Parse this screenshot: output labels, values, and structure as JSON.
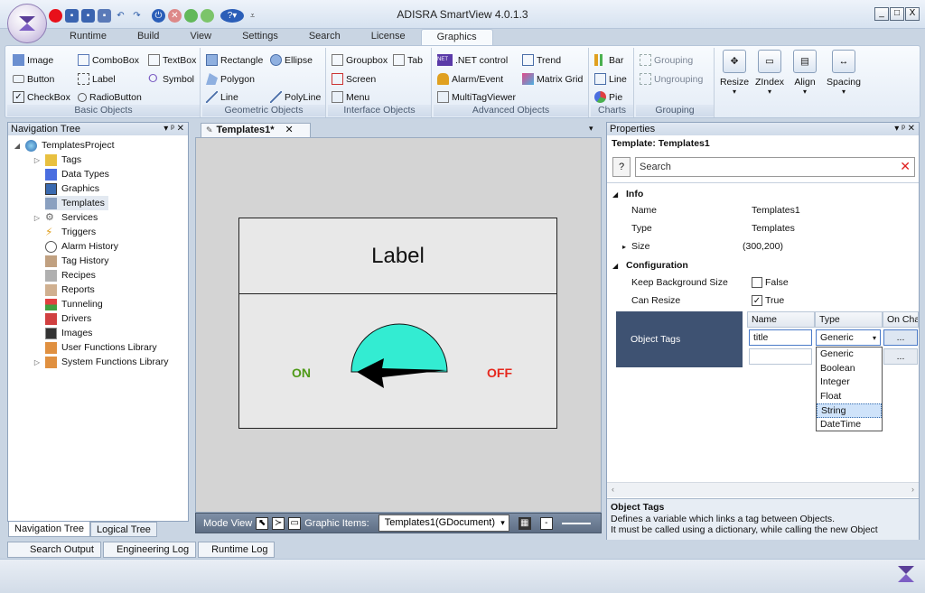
{
  "window": {
    "title": "ADISRA SmartView 4.0.1.3",
    "controls": [
      "_",
      "□",
      "X"
    ]
  },
  "ribbon": {
    "tabs": [
      "Runtime",
      "Build",
      "View",
      "Settings",
      "Search",
      "License",
      "Graphics"
    ],
    "active_tab": "Graphics",
    "groups": {
      "basic": {
        "label": "Basic Objects",
        "items": [
          "Image",
          "ComboBox",
          "TextBox",
          "Button",
          "Label",
          "Symbol",
          "CheckBox",
          "RadioButton"
        ]
      },
      "geometric": {
        "label": "Geometric Objects",
        "items": [
          "Rectangle",
          "Ellipse",
          "Polygon",
          "Line",
          "PolyLine"
        ]
      },
      "interface": {
        "label": "Interface Objects",
        "items": [
          "Groupbox",
          "Tab",
          "Screen",
          "Menu"
        ]
      },
      "advanced": {
        "label": "Advanced Objects",
        "items": [
          ".NET control",
          "Trend",
          "Alarm/Event",
          "Matrix Grid",
          "MultiTagViewer"
        ]
      },
      "charts": {
        "label": "Charts",
        "items": [
          "Bar",
          "Line",
          "Pie"
        ]
      },
      "grouping": {
        "label": "Grouping",
        "items": [
          "Grouping",
          "Ungrouping"
        ]
      },
      "layout": {
        "items": [
          "Resize",
          "ZIndex",
          "Align",
          "Spacing"
        ]
      }
    }
  },
  "nav": {
    "title": "Navigation Tree",
    "root": "TemplatesProject",
    "items": [
      "Tags",
      "Data Types",
      "Graphics",
      "Templates",
      "Services",
      "Triggers",
      "Alarm History",
      "Tag History",
      "Recipes",
      "Reports",
      "Tunneling",
      "Drivers",
      "Images",
      "User Functions Library",
      "System Functions Library"
    ],
    "selected": "Templates",
    "bottom_tabs": [
      "Navigation Tree",
      "Logical Tree"
    ]
  },
  "editor": {
    "tab_label": "Templates1*",
    "template": {
      "label_text": "Label",
      "on_text": "ON",
      "off_text": "OFF"
    },
    "mode_bar": {
      "mode_label": "Mode View",
      "graphic_items_label": "Graphic Items:",
      "graphic_items_value": "Templates1(GDocument)",
      "zoom_btn": "-"
    }
  },
  "properties": {
    "title": "Properties",
    "template_line": "Template:  Templates1",
    "help_btn": "?",
    "search_placeholder": "Search",
    "sections": {
      "info": "Info",
      "configuration": "Configuration"
    },
    "info": {
      "name_label": "Name",
      "name_value": "Templates1",
      "type_label": "Type",
      "type_value": "Templates",
      "size_label": "Size",
      "size_value": "(300,200)"
    },
    "config": {
      "keep_bg_label": "Keep Background Size",
      "keep_bg_value": "False",
      "can_resize_label": "Can Resize",
      "can_resize_value": "True"
    },
    "object_tags": {
      "label": "Object Tags",
      "columns": [
        "Name",
        "Type",
        "On Char"
      ],
      "row1": {
        "name": "title",
        "type": "Generic",
        "btn": "..."
      },
      "row2": {
        "btn": "..."
      },
      "dropdown_options": [
        "Generic",
        "Boolean",
        "Integer",
        "Float",
        "String",
        "DateTime"
      ],
      "highlighted": "String"
    },
    "help": {
      "title": "Object Tags",
      "line1": "Defines a variable which links a tag between Objects.",
      "line2": "It must be called using a dictionary, while calling the new Object"
    }
  },
  "output_tabs": [
    "Search Output",
    "Engineering Log",
    "Runtime Log"
  ],
  "colors": {
    "accent_dark": "#3e5272",
    "on_green": "#4f9a18",
    "off_red": "#e6281e",
    "gauge_cyan": "#33ecd2"
  }
}
